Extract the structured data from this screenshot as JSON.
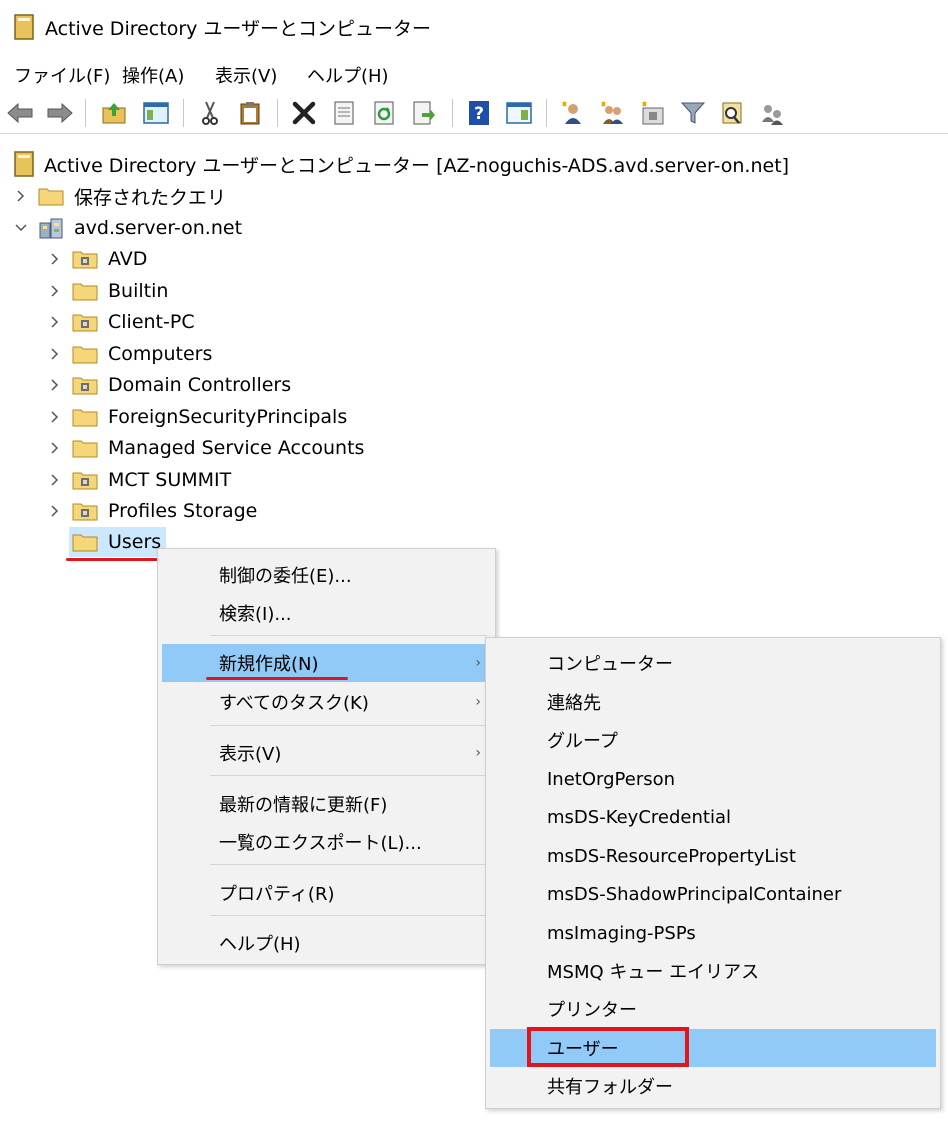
{
  "window": {
    "title": "Active Directory ユーザーとコンピューター"
  },
  "menubar": {
    "items": [
      "ファイル(F)",
      "操作(A)",
      "表示(V)",
      "ヘルプ(H)"
    ]
  },
  "toolbar": {
    "icons": [
      "back-icon",
      "forward-icon",
      "up-folder-icon",
      "show-console-tree-icon",
      "cut-icon",
      "paste-icon",
      "delete-icon",
      "properties-icon",
      "refresh-icon",
      "export-list-icon",
      "help-icon",
      "action-pane-icon",
      "new-user-icon",
      "new-group-icon",
      "new-ou-icon",
      "filter-icon",
      "find-icon",
      "add-to-group-icon"
    ]
  },
  "tree": {
    "root_label": "Active Directory ユーザーとコンピューター [AZ-noguchis-ADS.avd.server-on.net]",
    "saved_queries": "保存されたクエリ",
    "domain": "avd.server-on.net",
    "children": [
      "AVD",
      "Builtin",
      "Client-PC",
      "Computers",
      "Domain Controllers",
      "ForeignSecurityPrincipals",
      "Managed Service Accounts",
      "MCT SUMMIT",
      "Profiles Storage",
      "Users"
    ]
  },
  "context_menu": {
    "items": [
      "制御の委任(E)...",
      "検索(I)...",
      "新規作成(N)",
      "すべてのタスク(K)",
      "表示(V)",
      "最新の情報に更新(F)",
      "一覧のエクスポート(L)...",
      "プロパティ(R)",
      "ヘルプ(H)"
    ]
  },
  "submenu": {
    "items": [
      "コンピューター",
      "連絡先",
      "グループ",
      "InetOrgPerson",
      "msDS-KeyCredential",
      "msDS-ResourcePropertyList",
      "msDS-ShadowPrincipalContainer",
      "msImaging-PSPs",
      "MSMQ キュー エイリアス",
      "プリンター",
      "ユーザー",
      "共有フォルダー"
    ]
  },
  "colors": {
    "highlight": "#91c9f7",
    "selection": "#cce8ff",
    "annotation_red": "#e0151e",
    "folder_yellow": "#f5d77a"
  }
}
